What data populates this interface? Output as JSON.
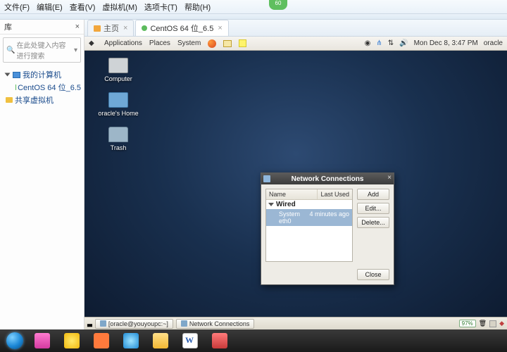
{
  "host": {
    "menus": [
      "文件(F)",
      "编辑(E)",
      "查看(V)",
      "虚拟机(M)",
      "选项卡(T)",
      "帮助(H)"
    ],
    "badge": "60",
    "sidebar": {
      "title": "库",
      "search_placeholder": "在此处键入内容进行搜索",
      "root": "我的计算机",
      "vm": "CentOS 64 位_6.5",
      "shared": "共享虚拟机"
    },
    "tabs": {
      "home": "主页",
      "active": "CentOS 64 位_6.5"
    }
  },
  "gnome": {
    "top": {
      "menus": [
        "Applications",
        "Places",
        "System"
      ],
      "date": "Mon Dec  8,  3:47 PM",
      "user": "oracle"
    },
    "desktop": {
      "computer": "Computer",
      "home": "oracle's Home",
      "trash": "Trash"
    },
    "bottom": {
      "term": "[oracle@youyoupc:~]",
      "netwin": "Network Connections",
      "battery": "97%"
    }
  },
  "dialog": {
    "title": "Network Connections",
    "cols": {
      "name": "Name",
      "last": "Last Used"
    },
    "group": "Wired",
    "row": {
      "name": "System eth0",
      "last": "4 minutes ago"
    },
    "btns": {
      "add": "Add",
      "edit": "Edit...",
      "delete": "Delete...",
      "close": "Close"
    }
  }
}
